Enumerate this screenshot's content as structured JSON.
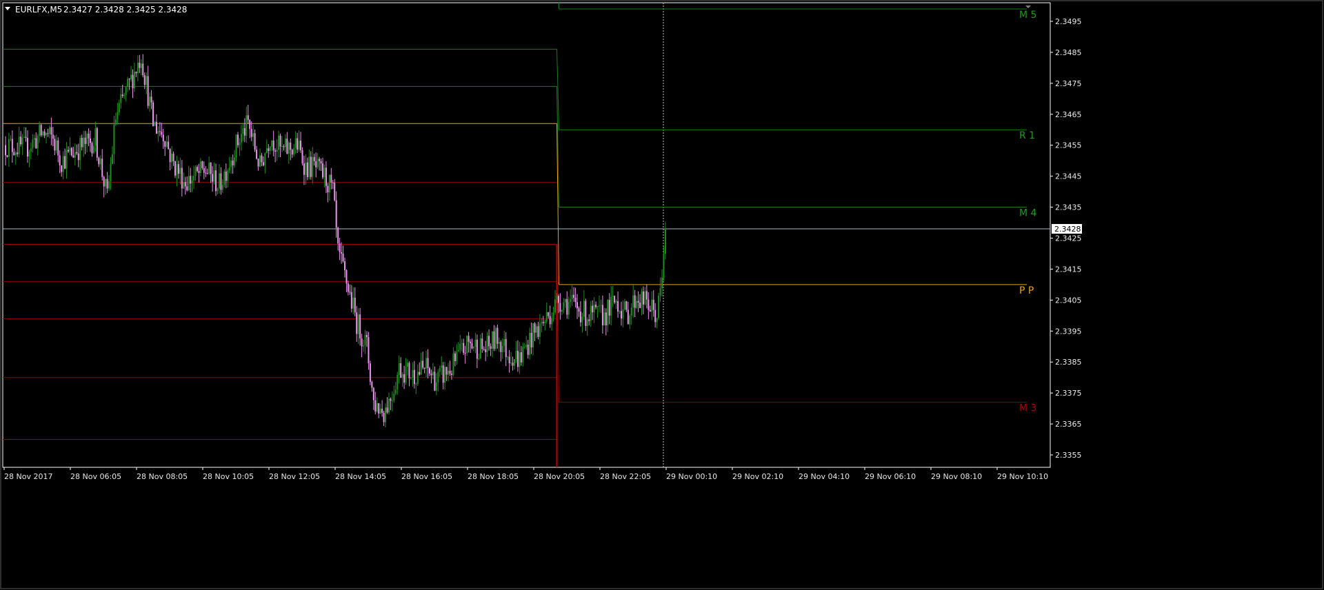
{
  "header": {
    "menu_arrow": "triangle-down-icon",
    "symbol": "EURLFX,M5",
    "ohlc": "2.3427 2.3428 2.3425 2.3428"
  },
  "colors": {
    "background": "#000000",
    "frame": "#ffffff",
    "bull_candle": "#1f8f1f",
    "bear_candle": "#e896e8",
    "green_level": "#1e7a1e",
    "red_level": "#8b0000",
    "pivot_level": "#e8a020",
    "bid_line": "#a8b8c8",
    "crosshair": "#c8c8c8"
  },
  "chart_data": {
    "type": "candlestick",
    "title": "",
    "xlabel": "",
    "ylabel": "",
    "ylim": [
      2.3351,
      2.3501
    ],
    "y_ticks": [
      "2.3495",
      "2.3485",
      "2.3475",
      "2.3465",
      "2.3455",
      "2.3445",
      "2.3435",
      "2.3425",
      "2.3415",
      "2.3405",
      "2.3395",
      "2.3385",
      "2.3375",
      "2.3365",
      "2.3355"
    ],
    "x_ticks": [
      "28 Nov 2017",
      "28 Nov 06:05",
      "28 Nov 08:05",
      "28 Nov 10:05",
      "28 Nov 12:05",
      "28 Nov 14:05",
      "28 Nov 16:05",
      "28 Nov 18:05",
      "28 Nov 20:05",
      "28 Nov 22:05",
      "29 Nov 00:10",
      "29 Nov 02:10",
      "29 Nov 04:10",
      "29 Nov 06:10",
      "29 Nov 08:10",
      "29 Nov 10:10"
    ],
    "current_price": "2.3428",
    "previous_day_levels": [
      2.3486,
      2.3474,
      2.3462,
      2.3443,
      2.3423,
      2.3411,
      2.3399,
      2.338,
      2.336
    ],
    "current_day_levels": [
      {
        "label": "M 5",
        "value": 2.3499,
        "color": "green"
      },
      {
        "label": "R 1",
        "value": 2.346,
        "color": "green"
      },
      {
        "label": "M 4",
        "value": 2.3435,
        "color": "green"
      },
      {
        "label": "P P",
        "value": 2.341,
        "color": "orange"
      },
      {
        "label": "M 3",
        "value": 2.3372,
        "color": "red"
      }
    ],
    "anchors": [
      [
        0,
        2.3455
      ],
      [
        12,
        2.3454
      ],
      [
        22,
        2.3459
      ],
      [
        28,
        2.3457
      ],
      [
        33,
        2.345
      ],
      [
        43,
        2.3454
      ],
      [
        53,
        2.3457
      ],
      [
        60,
        2.3438
      ],
      [
        65,
        2.3464
      ],
      [
        80,
        2.3484
      ],
      [
        87,
        2.3462
      ],
      [
        94,
        2.3458
      ],
      [
        98,
        2.345
      ],
      [
        106,
        2.3443
      ],
      [
        118,
        2.3447
      ],
      [
        126,
        2.3442
      ],
      [
        136,
        2.3455
      ],
      [
        143,
        2.3462
      ],
      [
        150,
        2.3448
      ],
      [
        156,
        2.3458
      ],
      [
        163,
        2.3453
      ],
      [
        172,
        2.3455
      ],
      [
        177,
        2.3448
      ],
      [
        182,
        2.3448
      ],
      [
        188,
        2.3445
      ],
      [
        193,
        2.344
      ],
      [
        196,
        2.342
      ],
      [
        201,
        2.3411
      ],
      [
        207,
        2.3398
      ],
      [
        213,
        2.339
      ],
      [
        217,
        2.3372
      ],
      [
        223,
        2.3369
      ],
      [
        228,
        2.3375
      ],
      [
        232,
        2.3383
      ],
      [
        240,
        2.3381
      ],
      [
        248,
        2.3383
      ],
      [
        254,
        2.3379
      ],
      [
        263,
        2.3383
      ],
      [
        267,
        2.3387
      ],
      [
        273,
        2.3391
      ],
      [
        283,
        2.3389
      ],
      [
        290,
        2.3393
      ],
      [
        296,
        2.3388
      ],
      [
        303,
        2.3386
      ],
      [
        310,
        2.3393
      ],
      [
        320,
        2.34
      ],
      [
        326,
        2.3405
      ],
      [
        333,
        2.3404
      ],
      [
        343,
        2.34
      ],
      [
        353,
        2.34
      ],
      [
        360,
        2.3405
      ],
      [
        366,
        2.34
      ],
      [
        372,
        2.3406
      ],
      [
        378,
        2.3404
      ],
      [
        384,
        2.34
      ],
      [
        387,
        2.3411
      ],
      [
        389,
        2.3428
      ]
    ],
    "bar_count": 390
  }
}
